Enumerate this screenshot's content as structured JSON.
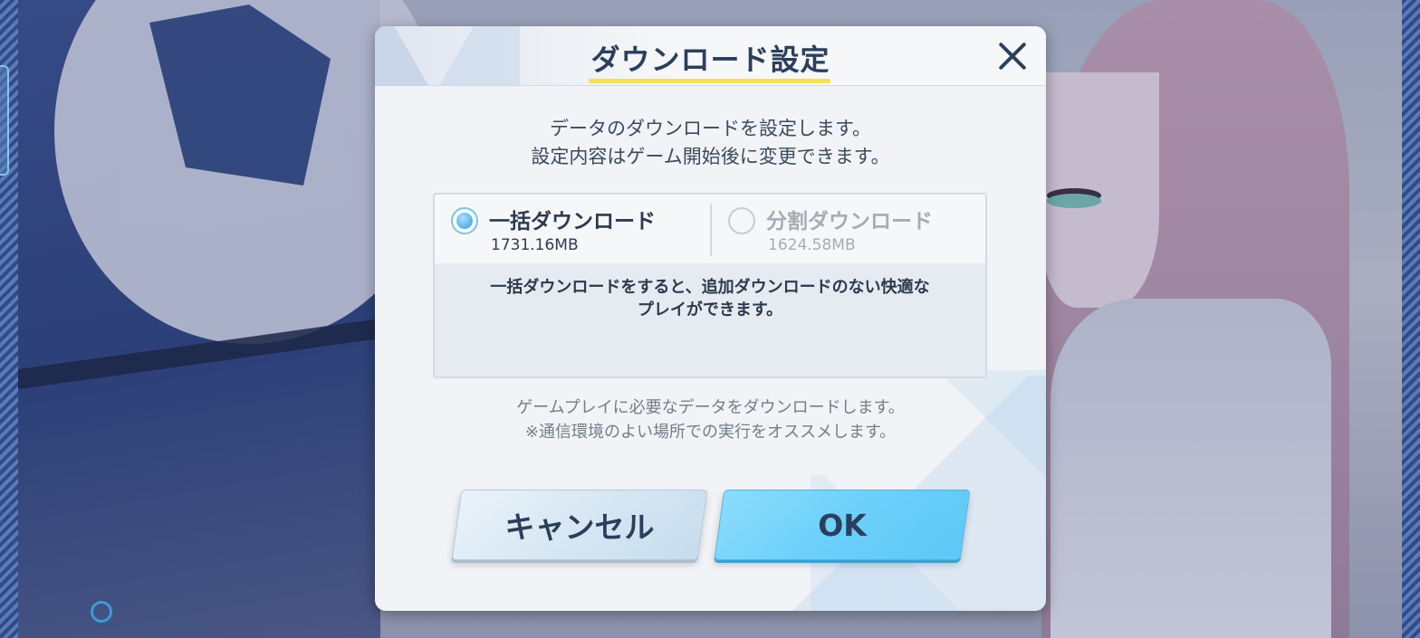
{
  "dialog": {
    "title": "ダウンロード設定",
    "description_line1": "データのダウンロードを設定します。",
    "description_line2": "設定内容はゲーム開始後に変更できます。",
    "options": [
      {
        "label": "一括ダウンロード",
        "size": "1731.16MB",
        "selected": true
      },
      {
        "label": "分割ダウンロード",
        "size": "1624.58MB",
        "selected": false
      }
    ],
    "option_description_line1": "一括ダウンロードをすると、追加ダウンロードのない快適な",
    "option_description_line2": "プレイができます。",
    "note_line1": "ゲームプレイに必要なデータをダウンロードします。",
    "note_line2": "※通信環境のよい場所での実行をオススメします。",
    "cancel_label": "キャンセル",
    "ok_label": "OK"
  },
  "colors": {
    "title_text": "#2b3f5c",
    "title_underline": "#f2e05a",
    "ok_button": "#6cd0fa",
    "cancel_button": "#d3e5f2",
    "radio_selected": "#2f9be0"
  },
  "icons": {
    "close": "close-icon",
    "bottom_left": "loading-ring-icon"
  }
}
